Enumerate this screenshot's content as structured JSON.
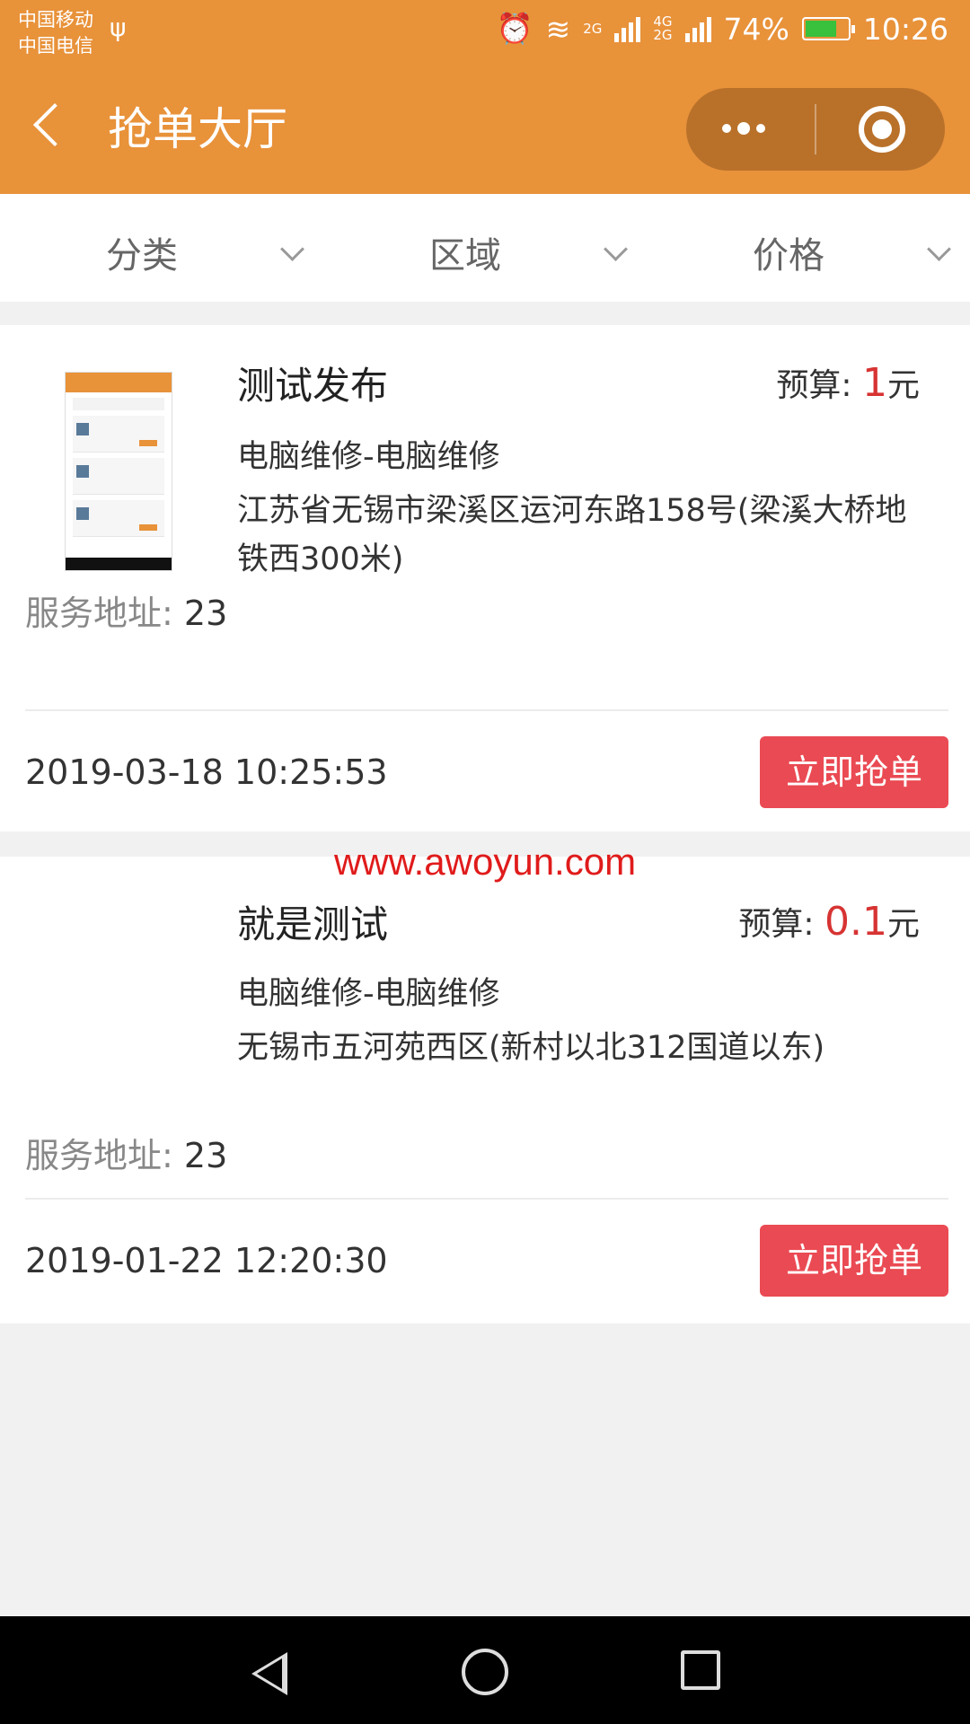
{
  "status_bar": {
    "carrier_1": "中国移动",
    "carrier_2": "中国电信",
    "usb_icon": "usb-icon",
    "alarm_icon": "alarm-icon",
    "net_1": "2G",
    "net_2": "4G\n2G",
    "battery_text": "74%",
    "battery_level": 0.74,
    "time": "10:26"
  },
  "nav": {
    "title": "抢单大厅",
    "back_icon": "back-icon",
    "more_icon": "more-icon",
    "close_icon": "close-icon"
  },
  "filters": [
    {
      "label": "分类"
    },
    {
      "label": "区域"
    },
    {
      "label": "价格"
    }
  ],
  "orders": [
    {
      "title": "测试发布",
      "budget_label": "预算:",
      "budget_value": "1",
      "budget_unit": "元",
      "category": "电脑维修-电脑维修",
      "address": "江苏省无锡市梁溪区运河东路158号(梁溪大桥地铁西300米)",
      "service_label": "服务地址:",
      "service_value": "23",
      "datetime": "2019-03-18 10:25:53",
      "button": "立即抢单"
    },
    {
      "title": "就是测试",
      "budget_label": "预算:",
      "budget_value": "0.1",
      "budget_unit": "元",
      "category": "电脑维修-电脑维修",
      "address": "无锡市五河苑西区(新村以北312国道以东)",
      "service_label": "服务地址:",
      "service_value": "23",
      "datetime": "2019-01-22 12:20:30",
      "button": "立即抢单"
    }
  ],
  "watermark": "www.awoyun.com",
  "colors": {
    "brand": "#e8923a",
    "button": "#ea4a53",
    "price": "#d73333"
  }
}
